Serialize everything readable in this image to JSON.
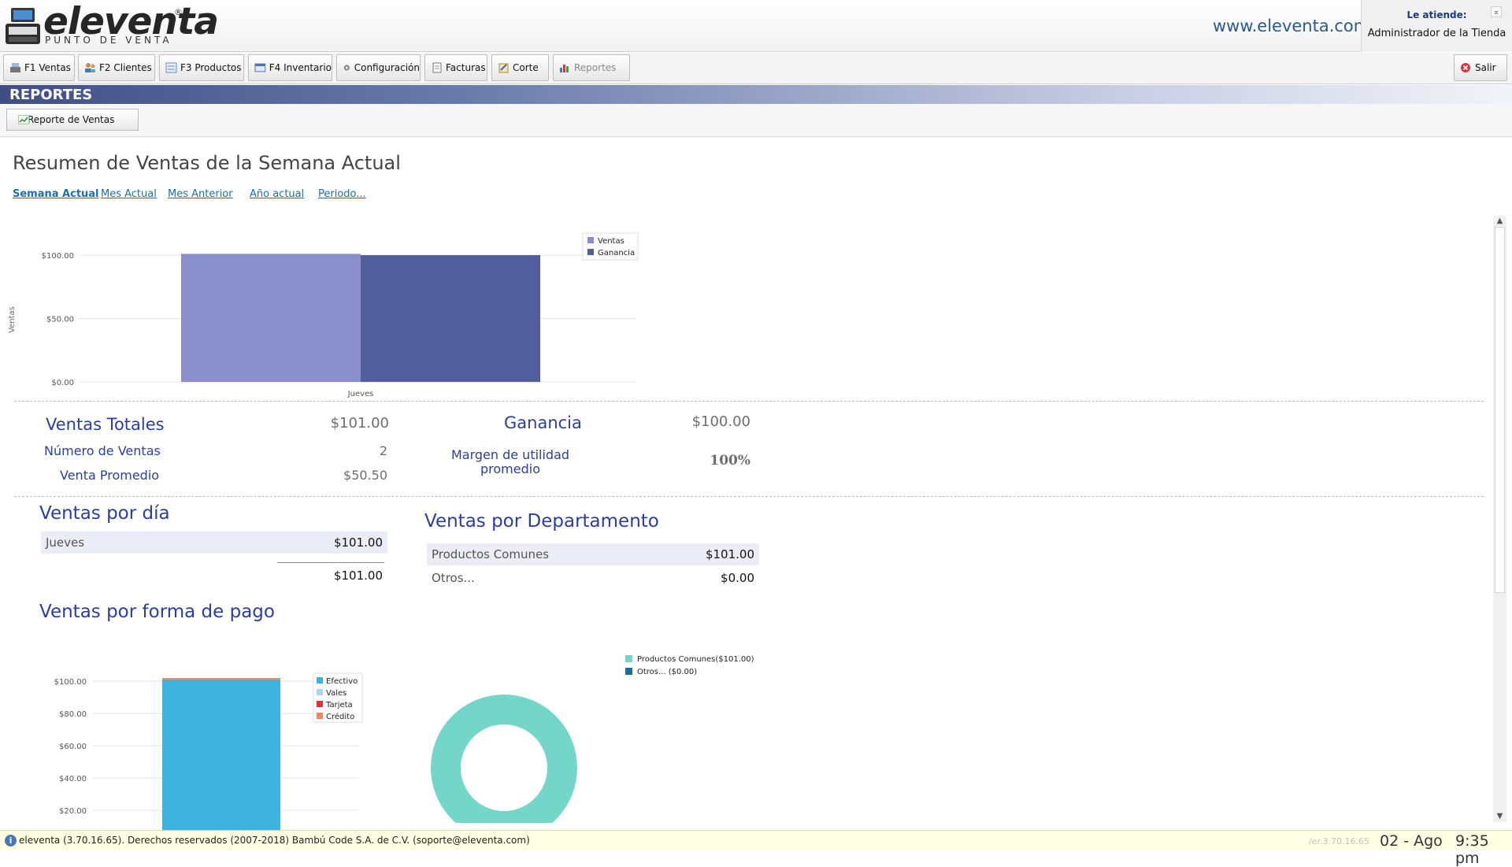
{
  "brand": {
    "name": "eleventa",
    "registered": "®",
    "subtitle": "PUNTO DE VENTA",
    "url": "www.eleventa.com"
  },
  "attendant": {
    "label": "Le atiende:",
    "name": "Administrador de la Tienda"
  },
  "toolbar": {
    "buttons": [
      {
        "label": "F1 Ventas",
        "icon": "cash-register-icon"
      },
      {
        "label": "F2 Clientes",
        "icon": "customers-icon"
      },
      {
        "label": "F3 Productos",
        "icon": "products-icon"
      },
      {
        "label": "F4 Inventario",
        "icon": "inventory-icon"
      },
      {
        "label": "Configuración",
        "icon": "gear-icon"
      },
      {
        "label": "Facturas",
        "icon": "invoice-icon"
      },
      {
        "label": "Corte",
        "icon": "cash-cut-icon"
      },
      {
        "label": "Reportes",
        "icon": "bar-chart-icon",
        "disabled": true
      }
    ],
    "exit_label": "Salir",
    "exit_icon": "exit-icon"
  },
  "section": {
    "title": "REPORTES",
    "report_button": "Reporte de Ventas"
  },
  "main": {
    "title": "Resumen de Ventas de la Semana Actual",
    "periods": [
      "Semana Actual",
      "Mes Actual",
      "Mes Anterior",
      "Año actual",
      "Periodo..."
    ],
    "active_period": "Semana Actual"
  },
  "chart_data": [
    {
      "type": "bar",
      "categories": [
        "Jueves"
      ],
      "series": [
        {
          "name": "Ventas",
          "values": [
            101.0
          ],
          "color": "#8a8ecc"
        },
        {
          "name": "Ganancia",
          "values": [
            100.0
          ],
          "color": "#535f9c"
        }
      ],
      "ylabel": "Ventas",
      "ylim": [
        0,
        100
      ],
      "yticks": [
        "$100.00",
        "$50.00",
        "$0.00"
      ],
      "ytick_values": [
        100,
        50,
        0
      ],
      "legend": "top-right",
      "grid": true
    },
    {
      "type": "bar",
      "stacked": true,
      "categories": [
        ""
      ],
      "series": [
        {
          "name": "Efectivo",
          "values": [
            101.0
          ],
          "color": "#3fb3e0"
        },
        {
          "name": "Vales",
          "values": [
            0
          ],
          "color": "#a9d6ef"
        },
        {
          "name": "Tarjeta",
          "values": [
            0
          ],
          "color": "#d9363e"
        },
        {
          "name": "Crédito",
          "values": [
            0
          ],
          "color": "#f08a5d"
        }
      ],
      "yticks": [
        "$100.00",
        "$80.00",
        "$60.00",
        "$40.00",
        "$20.00"
      ],
      "ytick_values": [
        100,
        80,
        60,
        40,
        20
      ],
      "ylim": [
        0,
        100
      ],
      "legend": "top-right",
      "grid": true
    },
    {
      "type": "pie",
      "donut": true,
      "labels": [
        "Productos Comunes($101.00)",
        "Otros... ($0.00)"
      ],
      "values": [
        101.0,
        0.0
      ],
      "colors": [
        "#74d6c8",
        "#1e6c95"
      ],
      "legend": "top-right"
    }
  ],
  "summary": {
    "total_sales_label": "Ventas Totales",
    "total_sales_value": "$101.00",
    "num_sales_label": "Número de Ventas",
    "num_sales_value": "2",
    "avg_sale_label": "Venta Promedio",
    "avg_sale_value": "$50.50",
    "profit_label": "Ganancia",
    "profit_value": "$100.00",
    "margin_label_1": "Margen de utilidad",
    "margin_label_2": "promedio",
    "margin_value": "100%"
  },
  "by_day": {
    "title": "Ventas por día",
    "rows": [
      {
        "label": "Jueves",
        "value": "$101.00"
      }
    ],
    "total": "$101.00"
  },
  "by_department": {
    "title": "Ventas por Departamento",
    "rows": [
      {
        "label": "Productos Comunes",
        "value": "$101.00"
      },
      {
        "label": "Otros...",
        "value": "$0.00"
      }
    ]
  },
  "by_payment": {
    "title": "Ventas por forma de pago"
  },
  "status": {
    "text": "eleventa (3.70.16.65). Derechos reservados (2007-2018) Bambú Code S.A. de C.V. (soporte@eleventa.com)",
    "version_faded": "/er.3.70.16.65",
    "date": "02 - Ago",
    "time": "9:35 pm"
  }
}
